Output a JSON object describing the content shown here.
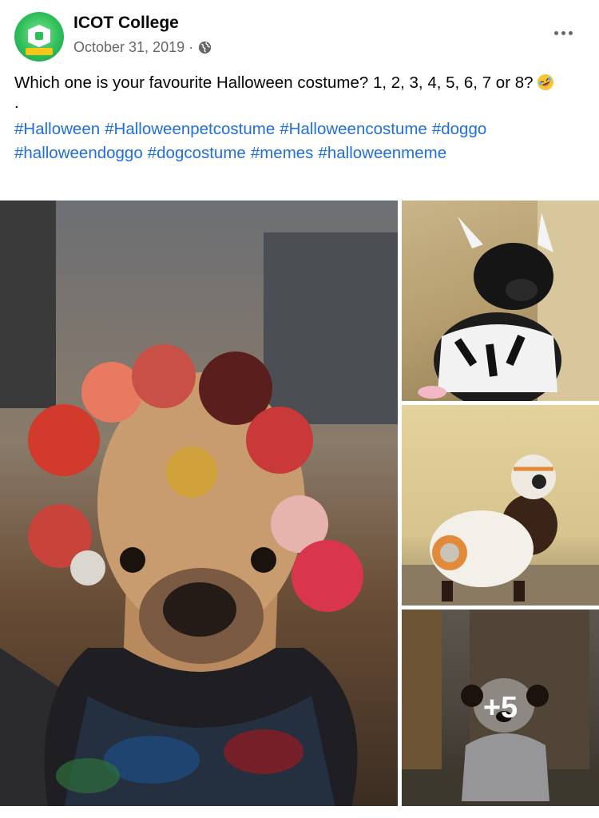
{
  "post": {
    "page_name": "ICOT College",
    "date": "October 31, 2019",
    "separator": "·",
    "privacy_icon": "globe-icon",
    "more_icon": "more-dots-icon",
    "text": "Which one is your favourite Halloween costume? 1, 2, 3, 4, 5, 6, 7 or 8?",
    "text_emoji": "rolling-on-floor-laughing-emoji",
    "dot_line": ".",
    "hashtags": [
      "#Halloween",
      "#Halloweenpetcostume",
      "#Halloweencostume",
      "#doggo",
      "#halloweendoggo",
      "#dogcostume",
      "#memes",
      "#halloweenmeme"
    ]
  },
  "photos": {
    "more_count": "+5"
  }
}
